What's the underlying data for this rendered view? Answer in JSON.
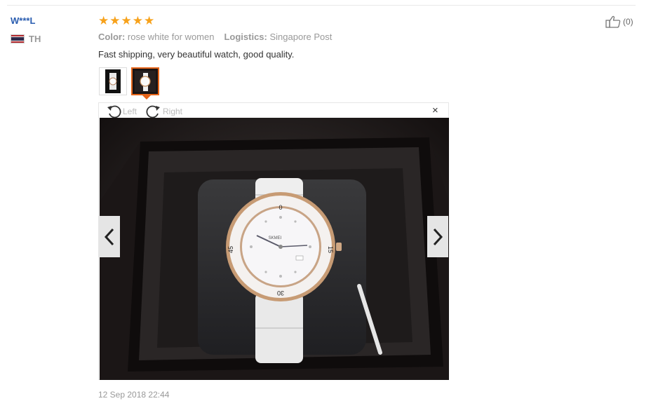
{
  "review": {
    "reviewer": "W***L",
    "country": "TH",
    "rating": 5,
    "likes": "(0)",
    "color_label": "Color:",
    "color_value": "rose white for women",
    "logistics_label": "Logistics:",
    "logistics_value": "Singapore Post",
    "text": "Fast shipping, very beautiful watch, good quality.",
    "date": "12 Sep 2018 22:44"
  },
  "viewer": {
    "rotate_left": "Left",
    "rotate_right": "Right",
    "close": "×"
  },
  "watch": {
    "bezel_marks": [
      "0",
      "15",
      "30",
      "45"
    ],
    "brand": "SKMEI"
  },
  "colors": {
    "star": "#f7a21b",
    "reviewer_link": "#2a5db0",
    "thumb_selected": "#e6651a",
    "flag_red": "#b3292e",
    "flag_white": "#f4f4f4",
    "flag_blue": "#2d2a4a"
  },
  "icons": [
    "thumbs-up-icon",
    "rotate-left-icon",
    "rotate-right-icon",
    "close-icon",
    "chevron-left-icon",
    "chevron-right-icon",
    "star-icon",
    "thailand-flag-icon"
  ]
}
